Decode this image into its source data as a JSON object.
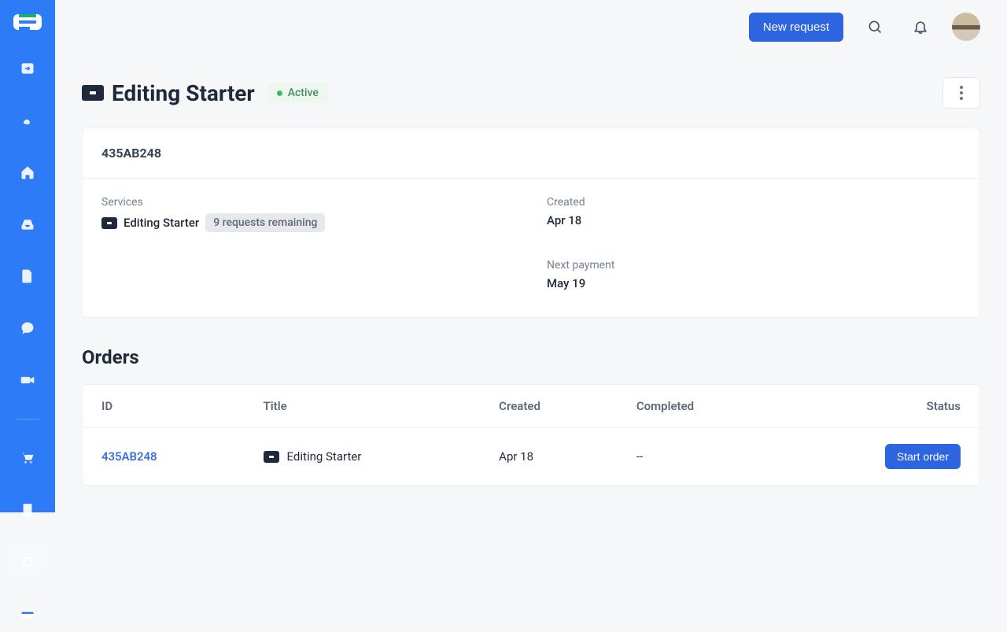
{
  "header": {
    "new_request_label": "New request"
  },
  "page": {
    "title": "Editing Starter",
    "status": "Active"
  },
  "details": {
    "code": "435AB248",
    "services_label": "Services",
    "service_name": "Editing Starter",
    "remaining": "9 requests remaining",
    "created_label": "Created",
    "created_value": "Apr 18",
    "next_payment_label": "Next payment",
    "next_payment_value": "May 19"
  },
  "orders": {
    "title": "Orders",
    "columns": {
      "id": "ID",
      "title": "Title",
      "created": "Created",
      "completed": "Completed",
      "status": "Status"
    },
    "rows": [
      {
        "id": "435AB248",
        "title": "Editing Starter",
        "created": "Apr 18",
        "completed": "--",
        "action": "Start order"
      }
    ]
  },
  "sidebar": {
    "icons": [
      "arrow-right-box",
      "handshake",
      "home",
      "inbox",
      "file",
      "chat",
      "video",
      "divider",
      "cart",
      "page",
      "refresh",
      "card"
    ]
  }
}
